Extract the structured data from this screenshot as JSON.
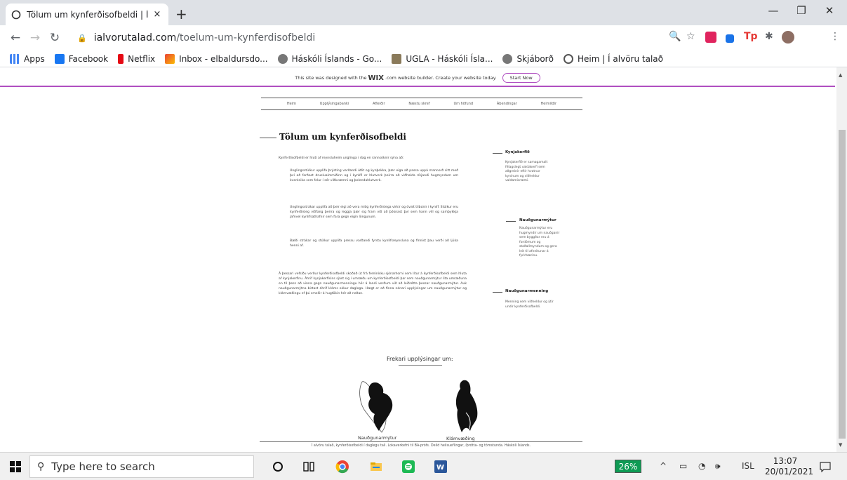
{
  "browser": {
    "tab_title": "Tölum um kynferðisofbeldi | Í alv",
    "tab_close": "×",
    "new_tab": "+",
    "url_host": "ialvorutalad.com",
    "url_path": "/toelum-um-kynferdisofbeldi",
    "window_minimize": "—",
    "window_restore": "❐",
    "window_close": "✕"
  },
  "bookmarks": [
    {
      "label": "Apps",
      "color": "#4285f4"
    },
    {
      "label": "Facebook",
      "color": "#1877f2"
    },
    {
      "label": "Netflix",
      "color": "#e50914"
    },
    {
      "label": "Inbox - elbaldursdo...",
      "color": "#ea4335"
    },
    {
      "label": "Háskóli Íslands - Go...",
      "color": "#555555"
    },
    {
      "label": "UGLA - Háskóli Ísla...",
      "color": "#8a7a5a"
    },
    {
      "label": "Skjáborð",
      "color": "#555555"
    },
    {
      "label": "Heim | Í alvöru talað",
      "color": "#555555"
    }
  ],
  "wix_banner": {
    "text_before": "This site was designed with the",
    "brand": "WIX",
    "text_after": ".com website builder. Create your website today.",
    "button": "Start Now"
  },
  "site": {
    "nav": [
      "Heim",
      "Upplýsingabanki",
      "Afleiðir",
      "Næstu skref",
      "Um höfund",
      "Ábendingar",
      "Heimildir"
    ],
    "page_title": "Tölum um kynferðisofbeldi",
    "intro": "Kynferðisofbeldi er hluti af reynsluheim unglinga í dag en rannsóknir sýna að:",
    "para1": "Unglingsstúlkur upplifa þrýsting varðandi útlit og kynþokka, þær eiga að passa uppá mannorð sitt með því að forðast drusluaímmiðinn og í kynlífi er hlutverk þeirra að viðhalda ríkjandi hugmyndum um kvenleika sem felur í sér viðkvæmni og þolendahlutverk.",
    "para2": "Unglingsstrákar upplifa að þeir eigi að vera miög kynferðislega virkir og óvalt tilbúnir í kynlíf. Stúlkur eru kynferðisleg viðfang þeirra og leggja þær sig fram við að þóknast því sem hann vill og samþykkja jafnvel kynlífsathafnir sem fara gegn eigin löngunum.",
    "para3": "Bæði strákar og stúlkur upplifa pressu varðandi fyrstu kynlífsreynsluna og finnist þau verði að ljúka henni af.",
    "para4": "Á þessari vefsíðu verður kynferðisofbeldi skoðað út frá femínísku sjónarhorni sem lítur á kynferðisofbeldi sem hluta af kynjakerfinu. Áhrif kynjakerfisins sjást sig í umræðu um kynferðisofbeldi þar sem nauðgunarmýtur lita umræðuna en til þess að vinna gegn nauðgunarmenningu hér á landi verðum við að leiðrétta þessar nauðgunarmýtur. Auk nauðgunarmýtna birtast áhrif kláms okkur daglega. Hægt er að finna nánari upplýsingar um nauðgunarmýtur og klámvæðingu ef þú smellir á hugtökin hér að neðan.",
    "side": [
      {
        "head": "Kynjakerfið",
        "text": "Kynjakerfið er samagamalt félagslegt valdakerfi sem aðgreinir eftir hvatnur kyninum og viðheldur valdamisræmi."
      },
      {
        "head": "Nauðgunarmýtur",
        "text": "Nauðgunarmýtur eru hugmyndir um nauðganir sem byggðar eru á fordómum og staðalímyndum og gera leit til afneitunar á fyrirbærinu."
      },
      {
        "head": "Nauðgunarmenning",
        "text": "Menning sem viðheldur og ýtir undir kynferðisofbeldi."
      }
    ],
    "more_info": "Frekari upplýsingar um:",
    "fig1_label": "Nauðgunarmýtur",
    "fig2_label": "Klámvæðing",
    "footer": "Í alvöru talað, kynferðisofbeldi í daglegu tali. Lokaverkefni til BA-prófs. Deild heilsueflingar, íþrótta- og tómstunda. Háskóli Íslands."
  },
  "taskbar": {
    "search_placeholder": "Type here to search",
    "battery": "26%",
    "lang": "ISL",
    "time": "13:07",
    "date": "20/01/2021"
  }
}
